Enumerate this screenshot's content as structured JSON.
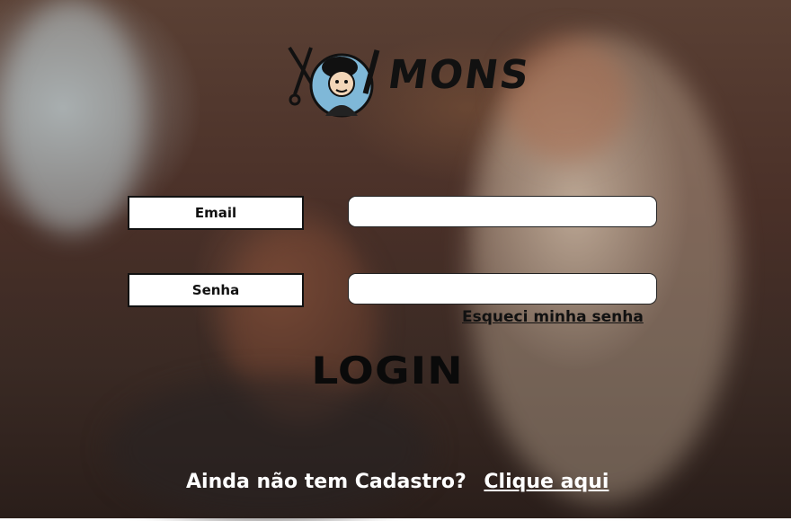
{
  "brand": {
    "logo_text": "MONS",
    "logo_icon": "barber-mascot-icon"
  },
  "form": {
    "email_label": "Email",
    "email_value": "",
    "password_label": "Senha",
    "password_value": "",
    "forgot_link": "Esqueci minha senha",
    "login_button": "LOGIN"
  },
  "footer": {
    "prompt": "Ainda não tem Cadastro?",
    "signup_link": "Clique aqui"
  }
}
